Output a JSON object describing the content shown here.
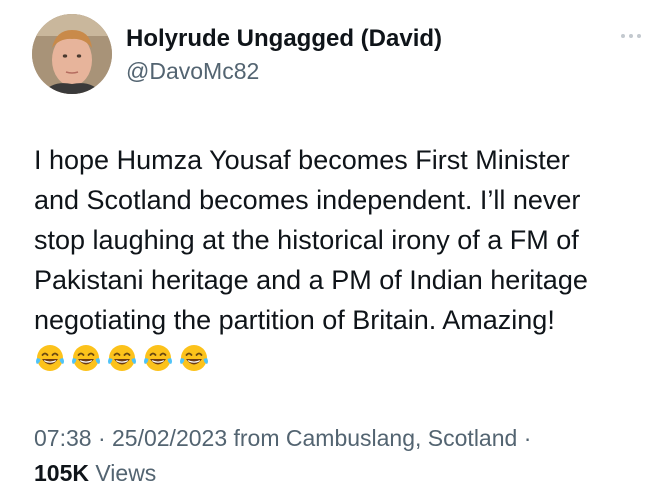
{
  "author": {
    "display_name": "Holyrude Ungagged (David)",
    "handle": "@DavoMc82"
  },
  "tweet": {
    "lines": [
      "I hope Humza Yousaf becomes First Minister",
      "and Scotland becomes independent.  I’ll never",
      "stop laughing at the historical irony of a FM of",
      "Pakistani heritage and a PM of Indian heritage",
      "negotiating the partition of Britain.  Amazing!"
    ],
    "emojis": [
      "face-with-tears-of-joy",
      "face-with-tears-of-joy",
      "face-with-tears-of-joy",
      "face-with-tears-of-joy",
      "face-with-tears-of-joy"
    ]
  },
  "meta": {
    "time_location": "07:38 · 25/02/2023 from Cambuslang, Scotland ·",
    "views_count": "105K",
    "views_label": "Views"
  },
  "icons": {
    "more": "more-horizontal-icon"
  },
  "colors": {
    "text_primary": "#0f1419",
    "text_secondary": "#536471",
    "emoji_face": "#fcc21b",
    "emoji_tears": "#4fc3f7"
  }
}
